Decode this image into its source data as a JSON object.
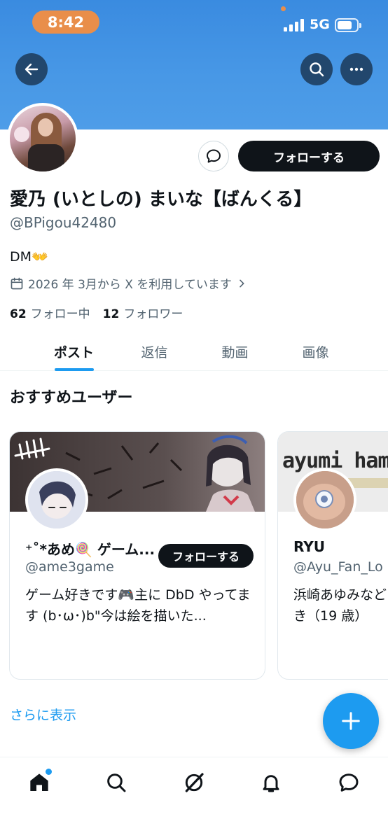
{
  "status_bar": {
    "time": "8:42",
    "network": "5G"
  },
  "profile": {
    "display_name": "愛乃 (いとしの) まいな【ばんくる】",
    "handle": "@BPigou42480",
    "bio": "DM👐",
    "joined": "2026 年 3月から X を利用しています",
    "following_count": "62",
    "following_label": "フォロー中",
    "followers_count": "12",
    "followers_label": "フォロワー",
    "follow_button": "フォローする"
  },
  "tabs": [
    {
      "label": "ポスト",
      "active": true
    },
    {
      "label": "返信",
      "active": false
    },
    {
      "label": "動画",
      "active": false
    },
    {
      "label": "画像",
      "active": false
    }
  ],
  "suggestions": {
    "title": "おすすめユーザー",
    "cards": [
      {
        "name": "⁺˚*あめ🍭 ゲーム...",
        "handle": "@ame3game",
        "bio": "ゲーム好きです🎮主に DbD やってます (b･ω･)b\"今は絵を描いた...",
        "follow_label": "フォローする"
      },
      {
        "banner_text": "ayumi hama",
        "name": "RYU",
        "handle": "@Ayu_Fan_Lo",
        "bio": "浜崎あゆみなど き（19 歳）"
      }
    ],
    "show_more": "さらに表示"
  },
  "colors": {
    "accent": "#1d9bf0",
    "header": "#3a8be0",
    "time_pill": "#e98e4a"
  },
  "icons": [
    "back-arrow-icon",
    "search-icon",
    "more-icon",
    "message-icon",
    "calendar-icon",
    "chevron-right-icon",
    "plus-icon",
    "home-icon",
    "explore-icon",
    "grok-icon",
    "bell-icon",
    "messages-icon"
  ]
}
